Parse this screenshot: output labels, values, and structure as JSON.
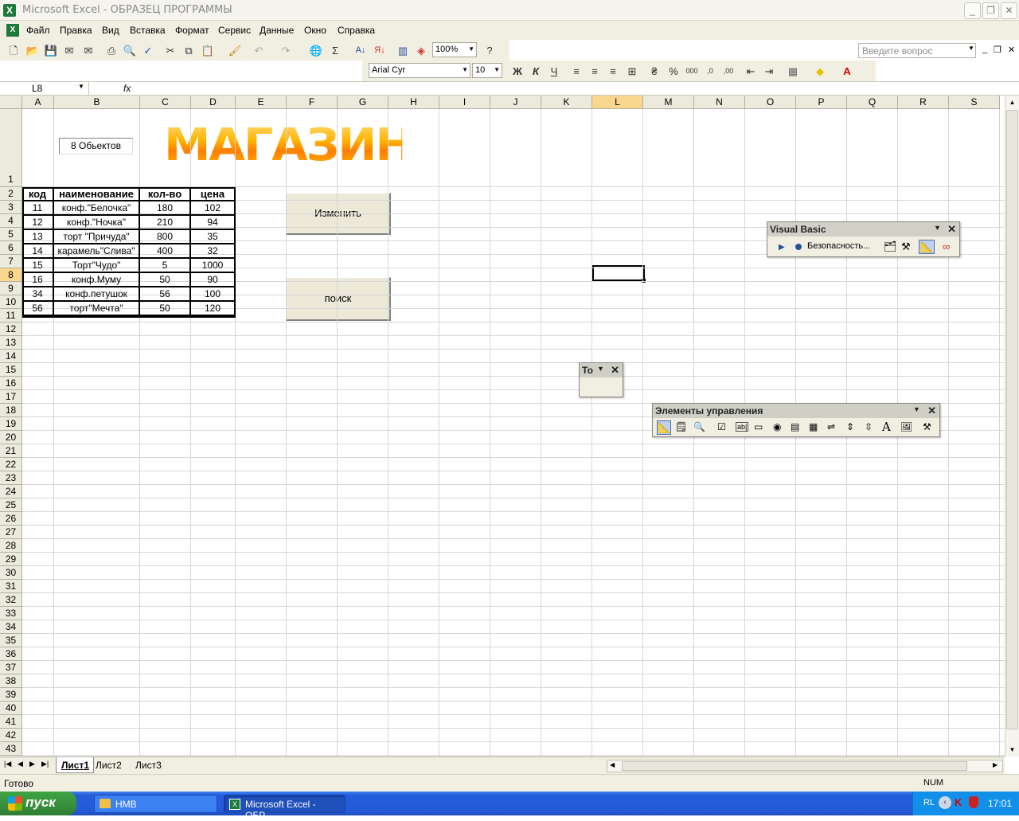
{
  "window": {
    "title": "Microsoft Excel - ОБРАЗЕЦ ПРОГРАММЫ",
    "min": "_",
    "max": "❐",
    "close": "✕"
  },
  "menu": [
    "Файл",
    "Правка",
    "Вид",
    "Вставка",
    "Формат",
    "Сервис",
    "Данные",
    "Окно",
    "Справка"
  ],
  "help_placeholder": "Введите вопрос",
  "zoom": "100%",
  "font_name": "Arial Cyr",
  "font_size": "10",
  "format_buttons": {
    "bold": "Ж",
    "italic": "К",
    "underline": "Ч"
  },
  "name_box": "L8",
  "fx": "fx",
  "columns": [
    "A",
    "B",
    "C",
    "D",
    "E",
    "F",
    "G",
    "H",
    "I",
    "J",
    "K",
    "L",
    "M",
    "N",
    "O",
    "P",
    "Q",
    "R",
    "S"
  ],
  "rows": [
    "1",
    "2",
    "3",
    "4",
    "5",
    "6",
    "7",
    "8",
    "9",
    "10",
    "11",
    "12",
    "13",
    "14",
    "15",
    "16",
    "17",
    "18",
    "19",
    "20",
    "21",
    "22",
    "23",
    "24",
    "25",
    "26",
    "27",
    "28",
    "29",
    "30",
    "31",
    "32",
    "33",
    "34",
    "35",
    "36",
    "37",
    "38",
    "39",
    "40",
    "41",
    "42",
    "43"
  ],
  "table": {
    "headers": [
      "код",
      "наименование",
      "кол-во",
      "цена"
    ],
    "rows": [
      [
        "11",
        "конф.\"Белочка\"",
        "180",
        "102"
      ],
      [
        "12",
        "конф.\"Ночка\"",
        "210",
        "94"
      ],
      [
        "13",
        "торт \"Причуда\"",
        "800",
        "35"
      ],
      [
        "14",
        "карамель\"Слива\"",
        "400",
        "32"
      ],
      [
        "15",
        "Торт\"Чудо\"",
        "5",
        "1000"
      ],
      [
        "16",
        "конф.Муму",
        "50",
        "90"
      ],
      [
        "34",
        "конф.петушок",
        "56",
        "100"
      ],
      [
        "56",
        "торт\"Мечта\"",
        "50",
        "120"
      ]
    ]
  },
  "objects_label": "8  Обьектов",
  "wordart": "МАГАЗИН",
  "buttons": {
    "change": "Изменить",
    "search": "поиск"
  },
  "vb_toolbar": {
    "title": "Visual Basic",
    "security": "Безопасность..."
  },
  "to_toolbar": {
    "title": "То"
  },
  "controls_toolbar": {
    "title": "Элементы управления"
  },
  "sheets": [
    "Лист1",
    "Лист2",
    "Лист3"
  ],
  "status": {
    "left": "Готово",
    "num": "NUM"
  },
  "taskbar": {
    "start": "пуск",
    "tasks": [
      "HMB",
      "Microsoft Excel - ОБР..."
    ],
    "lang": "RL",
    "time": "17:01"
  }
}
